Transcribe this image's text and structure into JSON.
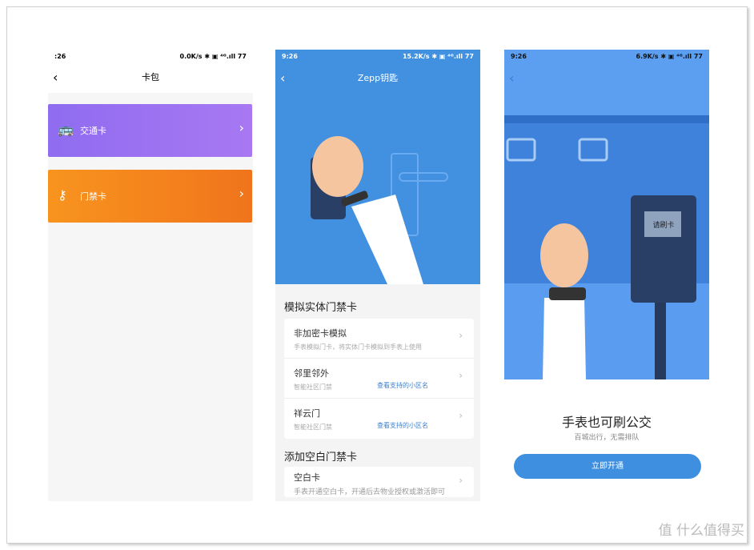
{
  "panel1": {
    "status": {
      "time": ":26",
      "right": "0.0K/s ✱ ▣ ⁴ᴳ.ıll 77"
    },
    "title": "卡包",
    "cards": [
      {
        "label": "交通卡",
        "icon": "bus-icon",
        "color": "#9a6cf0"
      },
      {
        "label": "门禁卡",
        "icon": "key-icon",
        "color": "#f27d1c"
      }
    ]
  },
  "panel2": {
    "status": {
      "time": "9:26",
      "right": "15.2K/s ✱ ▣ ⁴ᴳ.ıll 77"
    },
    "title": "Zepp钥匙",
    "section1": "模拟实体门禁卡",
    "items": [
      {
        "title": "非加密卡模拟",
        "sub": "手表模拟门卡，将实体门卡模拟到手表上使用",
        "link": ""
      },
      {
        "title": "邻里邻外",
        "sub": "智能社区门禁",
        "link": "查看支持的小区名"
      },
      {
        "title": "祥云门",
        "sub": "智能社区门禁",
        "link": "查看支持的小区名"
      }
    ],
    "section2": "添加空白门禁卡",
    "blank": {
      "title": "空白卡",
      "sub": "手表开通空白卡，开通后去物业授权或激活即可"
    },
    "accent": "#3f8fe0"
  },
  "panel3": {
    "status": {
      "time": "9:26",
      "right": "6.9K/s ✱ ▣ ⁴ᴳ.ıll 77"
    },
    "reader_label": "请刷卡",
    "headline": "手表也可刷公交",
    "subline": "百城出行，无需排队",
    "button": "立即开通",
    "accent": "#3f8fe0"
  },
  "watermark": "值 什么值得买"
}
